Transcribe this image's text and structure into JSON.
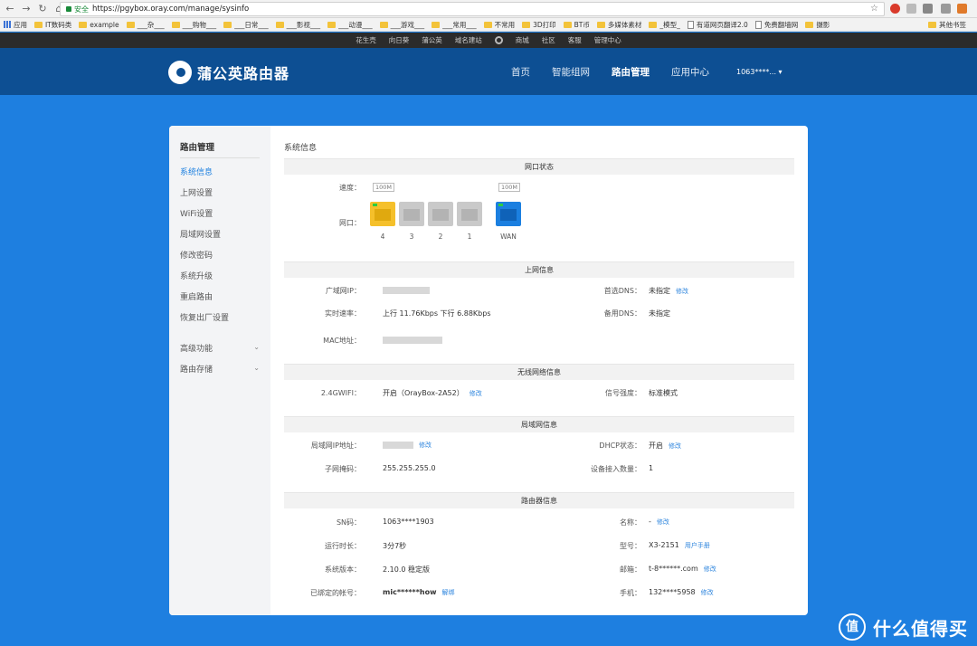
{
  "browser": {
    "security_label": "安全",
    "url": "https://pgybox.oray.com/manage/sysinfo",
    "bookmarks": [
      "应用",
      "IT数码类",
      "example",
      "___杂___",
      "___购物___",
      "___日常___",
      "___影视___",
      "___动漫___",
      "___游戏___",
      "___常用___",
      "不常用",
      "3D打印",
      "BT币",
      "多媒体素材",
      "_模型_",
      "有道网页翻译2.0",
      "免费翻墙网",
      "摄影"
    ],
    "bookmarks_other": "其他书签"
  },
  "oray_bar": {
    "items": [
      "花生壳",
      "向日葵",
      "蒲公英",
      "域名建站",
      "商城",
      "社区",
      "客服",
      "管理中心"
    ]
  },
  "header": {
    "logo_text": "蒲公英路由器",
    "nav": [
      "首页",
      "智能组网",
      "路由管理",
      "应用中心"
    ],
    "account": "1063****..."
  },
  "sidebar": {
    "title": "路由管理",
    "items": [
      "系统信息",
      "上网设置",
      "WiFi设置",
      "局域网设置",
      "修改密码",
      "系统升级",
      "重启路由",
      "恢复出厂设置"
    ],
    "groups": [
      "高级功能",
      "路由存储"
    ]
  },
  "content": {
    "title": "系统信息",
    "port_status": {
      "heading": "网口状态",
      "speed_label": "速度：",
      "port_label": "网口：",
      "lan_speed": "100M",
      "wan_speed": "100M",
      "ports": [
        "4",
        "3",
        "2",
        "1"
      ],
      "wan": "WAN"
    },
    "internet": {
      "heading": "上网信息",
      "wan_ip_label": "广域网IP：",
      "rate_label": "实时速率：",
      "rate_value": "上行 11.76Kbps  下行 6.88Kbps",
      "mac_label": "MAC地址：",
      "dns1_label": "首选DNS：",
      "dns1_value": "未指定",
      "dns2_label": "备用DNS：",
      "dns2_value": "未指定",
      "edit": "修改"
    },
    "wireless": {
      "heading": "无线网络信息",
      "wifi_label": "2.4GWIFI：",
      "wifi_value": "开启（OrayBox-2A52）",
      "signal_label": "信号强度：",
      "signal_value": "标准模式",
      "edit": "修改"
    },
    "lan": {
      "heading": "局域网信息",
      "ip_label": "局域网IP地址：",
      "mask_label": "子网掩码：",
      "mask_value": "255.255.255.0",
      "dhcp_label": "DHCP状态：",
      "dhcp_value": "开启",
      "devices_label": "设备接入数量：",
      "devices_value": "1",
      "edit": "修改"
    },
    "router": {
      "heading": "路由器信息",
      "sn_label": "SN码：",
      "sn_value": "1063****1903",
      "uptime_label": "运行时长：",
      "uptime_value": "3分7秒",
      "version_label": "系统版本：",
      "version_value": "2.10.0 稳定版",
      "account_label": "已绑定的帐号：",
      "account_value": "mic******how",
      "unbind": "解绑",
      "name_label": "名称：",
      "name_value": "-",
      "model_label": "型号：",
      "model_value": "X3-2151",
      "manual": "用户手册",
      "email_label": "邮箱：",
      "email_value": "t-8******.com",
      "phone_label": "手机：",
      "phone_value": "132****5958",
      "edit": "修改"
    }
  },
  "watermark": {
    "mark": "值",
    "text": "什么值得买"
  },
  "colors": {
    "page_bg": "#1e7fe0",
    "header_bg": "#0d4f93",
    "accent": "#1b7fe0",
    "port_active": "#f5c02b",
    "port_wan": "#1b7fe0"
  }
}
